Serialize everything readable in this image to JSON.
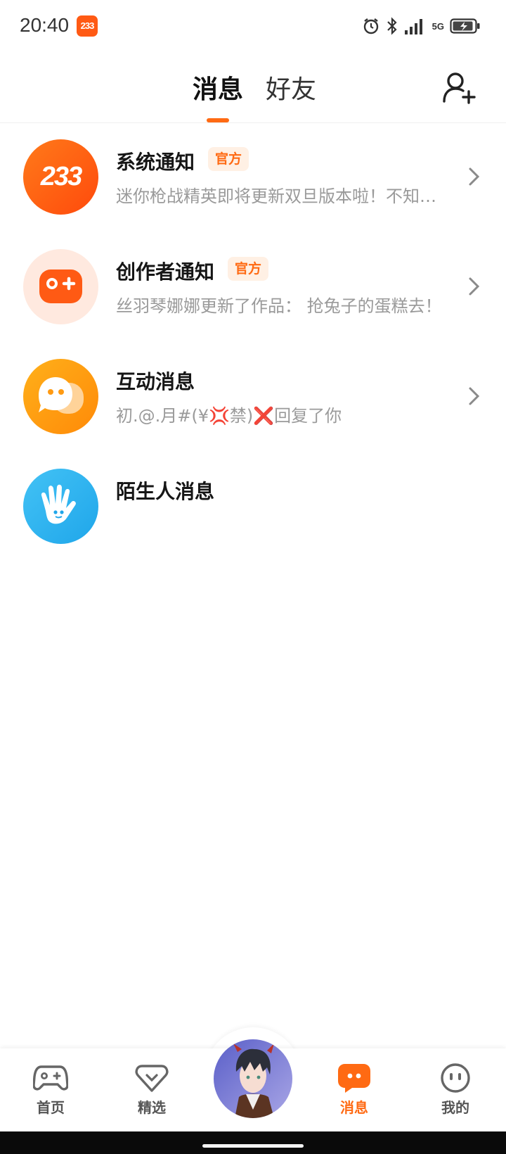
{
  "status_bar": {
    "time": "20:40",
    "app_badge": "233",
    "network": "5G",
    "icons": [
      "alarm-icon",
      "bluetooth-icon",
      "signal-icon",
      "battery-charging-icon"
    ]
  },
  "header": {
    "tabs": [
      {
        "label": "消息",
        "active": true
      },
      {
        "label": "好友",
        "active": false
      }
    ],
    "add_friend_icon": "add-person-icon"
  },
  "messages": [
    {
      "title": "系统通知",
      "tag": "官方",
      "preview": "迷你枪战精英即将更新双旦版本啦！不知道...",
      "avatar": "233",
      "has_chevron": true
    },
    {
      "title": "创作者通知",
      "tag": "官方",
      "preview": "丝羽琴娜娜更新了作品：  抢兔子的蛋糕去！",
      "avatar": "gamepad-icon",
      "has_chevron": true
    },
    {
      "title": "互动消息",
      "tag": "",
      "preview": "初.@.月#(¥💢禁)❌回复了你",
      "avatar": "chat-bubble-icon",
      "has_chevron": true
    },
    {
      "title": "陌生人消息",
      "tag": "",
      "preview": "",
      "avatar": "hand-wave-icon",
      "has_chevron": false
    }
  ],
  "bottom_nav": {
    "items": [
      {
        "label": "首页",
        "icon": "gamepad-icon",
        "active": false
      },
      {
        "label": "精选",
        "icon": "heart-diamond-icon",
        "active": false
      },
      {
        "label": "",
        "icon": "user-avatar",
        "active": false
      },
      {
        "label": "消息",
        "icon": "chat-icon",
        "active": true
      },
      {
        "label": "我的",
        "icon": "face-icon",
        "active": false
      }
    ]
  },
  "colors": {
    "accent": "#ff6a13",
    "tag_bg": "#fff0e4",
    "preview_text": "#9a9a9a",
    "blue": "#2fb2f0"
  }
}
